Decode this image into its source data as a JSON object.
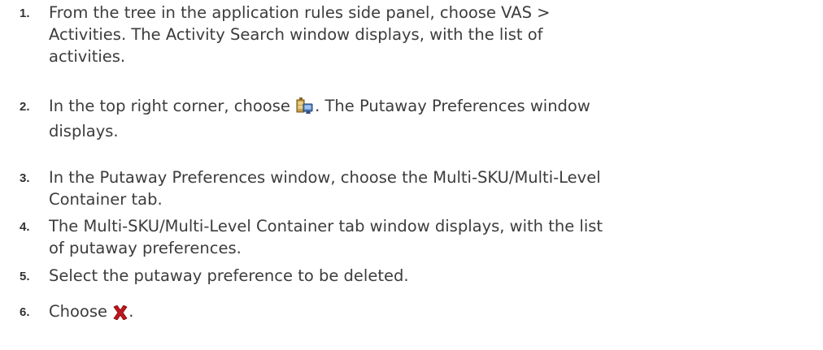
{
  "steps": [
    {
      "number": "1.",
      "text": "From the tree in the application rules side panel, choose VAS > Activities. The Activity Search window displays, with the list of activities."
    },
    {
      "number": "2.",
      "before": "In the top right corner, choose ",
      "icon": "putaway-preferences-icon",
      "after": ". The Putaway Preferences window displays."
    },
    {
      "number": "3.",
      "text": "In the Putaway Preferences window, choose the Multi-SKU/Multi-Level Container tab."
    },
    {
      "number": "4.",
      "text": "The Multi-SKU/Multi-Level Container tab window displays, with the list of putaway preferences."
    },
    {
      "number": "5.",
      "text": "Select the putaway preference to be deleted."
    },
    {
      "number": "6.",
      "before": "Choose ",
      "icon": "delete-icon",
      "after": "."
    }
  ]
}
